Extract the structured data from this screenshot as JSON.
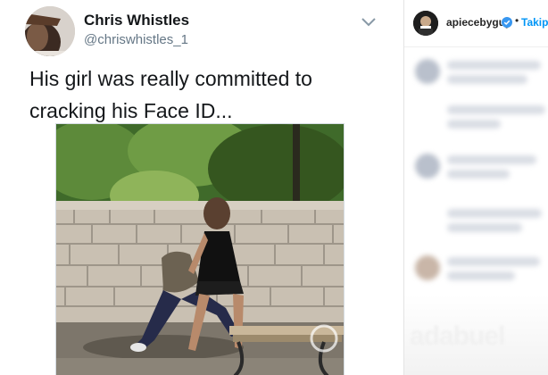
{
  "tweet": {
    "display_name": "Chris Whistles",
    "handle": "@chriswhistles_1",
    "text": "His girl was really committed to cracking his Face ID..."
  },
  "instagram": {
    "username": "apiecebyguy",
    "separator": "•",
    "follow_label": "Takip E",
    "watermark": "adabuel",
    "accent_color": "#0095f6"
  },
  "icons": [
    "chevron-down-icon",
    "verified-badge-icon"
  ]
}
